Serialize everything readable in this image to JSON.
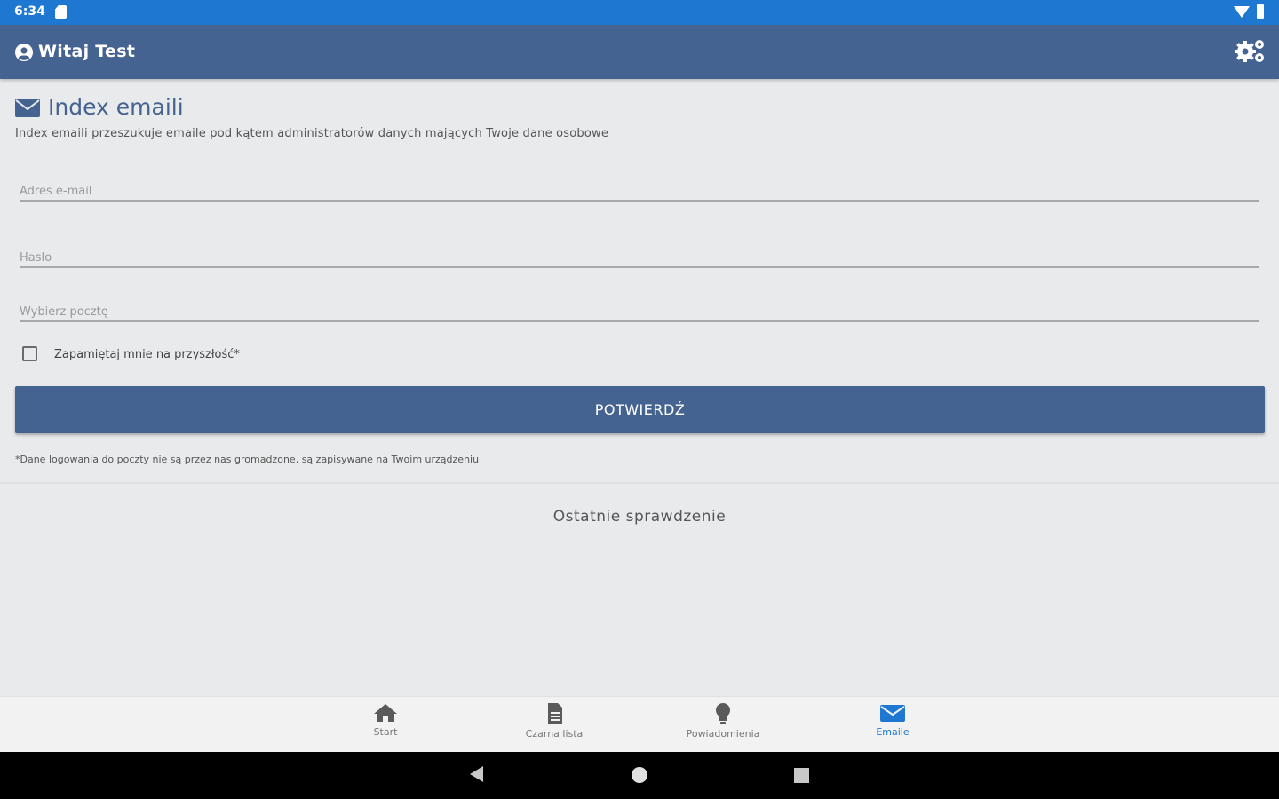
{
  "status_bar": {
    "time": "6:34"
  },
  "app_bar": {
    "greeting": "Witaj Test",
    "icons": {
      "user": "user-circle-icon",
      "settings": "gears-icon"
    }
  },
  "section": {
    "title": "Index emaili",
    "description": "Index emaili przeszukuje emaile pod kątem administratorów danych mających Twoje dane osobowe"
  },
  "form": {
    "email_placeholder": "Adres e-mail",
    "password_placeholder": "Hasło",
    "mail_select_placeholder": "Wybierz pocztę",
    "remember_label": "Zapamiętaj mnie na przyszłość*",
    "remember_checked": false,
    "submit_label": "POTWIERDŹ",
    "footnote": "*Dane logowania do poczty nie są przez nas gromadzone, są zapisywane na Twoim urządzeniu"
  },
  "last_check": {
    "title": "Ostatnie sprawdzenie"
  },
  "bottom_nav": {
    "items": [
      {
        "label": "Start",
        "icon": "home-icon",
        "active": false
      },
      {
        "label": "Czarna lista",
        "icon": "document-icon",
        "active": false
      },
      {
        "label": "Powiadomienia",
        "icon": "lightbulb-icon",
        "active": false
      },
      {
        "label": "Emaile",
        "icon": "envelope-icon",
        "active": true
      }
    ]
  },
  "colors": {
    "primary": "#456390",
    "status_bar": "#1e78d2",
    "active_nav": "#1e78d2",
    "background": "#e9eaec"
  }
}
